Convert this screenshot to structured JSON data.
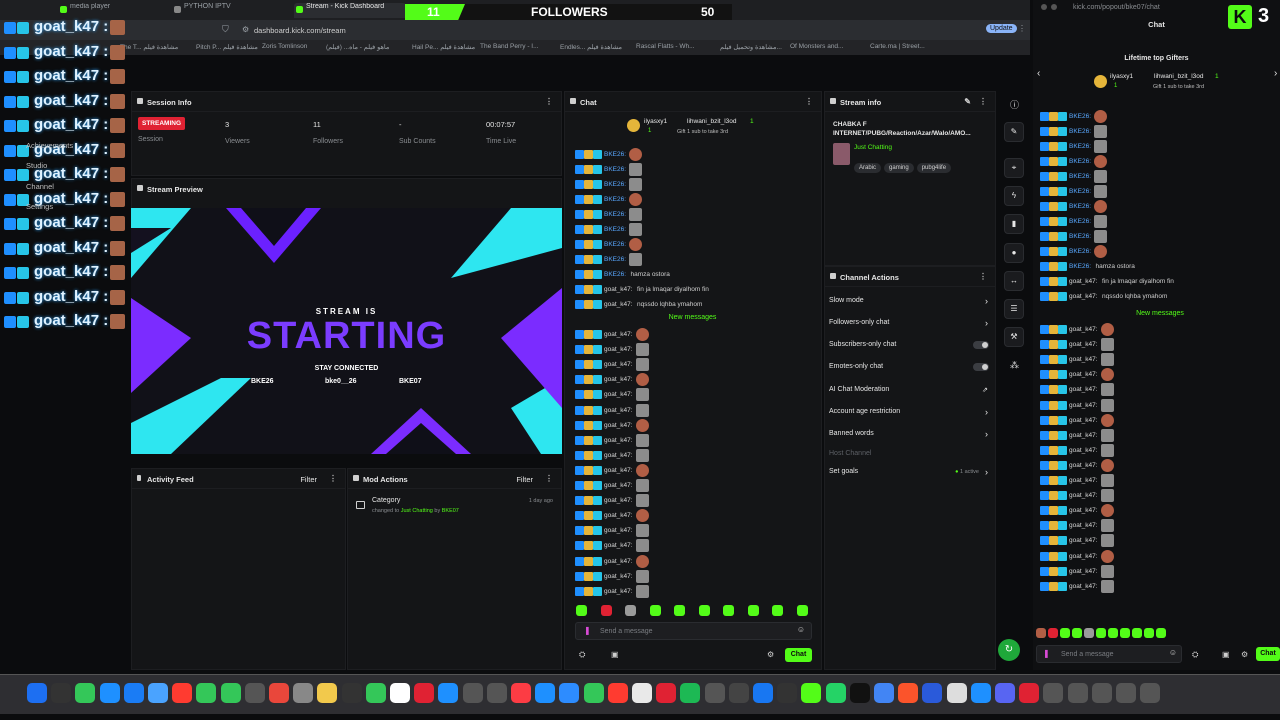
{
  "browser": {
    "tabs": [
      {
        "label": "media player"
      },
      {
        "label": "PYTHON IPTV"
      },
      {
        "label": "Stream - Kick Dashboard"
      }
    ],
    "url": "dashboard.kick.com/stream",
    "update_label": "Update",
    "bookmarks": [
      "The T... مشاهدة فيلم",
      "Pitch P... مشاهدة فيلم",
      "Zoris Tomlinson",
      "ماهو فيلم - ماه... (فيلم)",
      "Hail Pe... مشاهدة فيلم",
      "The Band Perry - I...",
      "Endles... مشاهدة فيلم",
      "Rascal Flatts - Wh...",
      "مشاهدة وتحميل فيلم...",
      "Of Monsters and...",
      "Carte.ma | Street..."
    ]
  },
  "follower_goal": {
    "current": "11",
    "label": "FOLLOWERS",
    "target": "50",
    "progress": 0.22
  },
  "overlay": {
    "rows": [
      "goat_k47 :",
      "goat_k47 :",
      "goat_k47 :",
      "goat_k47 :",
      "goat_k47 :",
      "goat_k47 :",
      "goat_k47 :",
      "goat_k47 :",
      "goat_k47 :",
      "goat_k47 :",
      "goat_k47 :",
      "goat_k47 :",
      "goat_k47 :"
    ],
    "menu": [
      "Achievements",
      "Studio",
      "Channel",
      "Settings"
    ]
  },
  "session": {
    "title": "Session Info",
    "status": "STREAMING",
    "session_label": "Session",
    "viewers": "3",
    "viewers_label": "Viewers",
    "followers": "11",
    "followers_label": "Followers",
    "subs": "-",
    "subs_label": "Sub Counts",
    "time": "00:07:57",
    "time_label": "Time Live"
  },
  "preview": {
    "title": "Stream Preview",
    "line1": "STREAM IS",
    "line2": "STARTING",
    "line3": "STAY CONNECTED",
    "handles": [
      "BKE26",
      "bke0__26",
      "BKE07"
    ]
  },
  "activity": {
    "title": "Activity Feed",
    "filter": "Filter"
  },
  "mod_actions": {
    "title": "Mod Actions",
    "filter": "Filter",
    "item_title": "Category",
    "item_prefix": "changed to",
    "item_value": "Just Chatting",
    "item_by": "by",
    "item_user": "BKE07",
    "item_time": "1 day ago"
  },
  "chat": {
    "title": "Chat",
    "gifter1": "ilyasxy1",
    "gifter1_count": "1",
    "gifter2": "lihwani_bzit_l3od",
    "gifter2_count": "1",
    "gift_note": "Gift 1 sub to take 3rd",
    "messages_top": [
      {
        "user": "BKE26:",
        "text": ""
      },
      {
        "user": "BKE26:",
        "text": ""
      },
      {
        "user": "BKE26:",
        "text": ""
      },
      {
        "user": "BKE26:",
        "text": ""
      },
      {
        "user": "BKE26:",
        "text": ""
      },
      {
        "user": "BKE26:",
        "text": ""
      },
      {
        "user": "BKE26:",
        "text": ""
      },
      {
        "user": "BKE26:",
        "text": ""
      },
      {
        "user": "BKE26:",
        "text": "hamza ostora"
      },
      {
        "user": "goat_k47:",
        "text": "fin ja lmaqar diyalhom fin"
      },
      {
        "user": "goat_k47:",
        "text": "nqssdo lqhba ymahom"
      }
    ],
    "new_messages": "New messages",
    "messages_bottom": [
      "goat_k47:",
      "goat_k47:",
      "goat_k47:",
      "goat_k47:",
      "goat_k47:",
      "goat_k47:",
      "goat_k47:",
      "goat_k47:",
      "goat_k47:",
      "goat_k47:",
      "goat_k47:",
      "goat_k47:",
      "goat_k47:",
      "goat_k47:",
      "goat_k47:",
      "goat_k47:",
      "goat_k47:",
      "goat_k47:"
    ],
    "placeholder": "Send a message",
    "send": "Chat"
  },
  "stream_info": {
    "title": "Stream info",
    "stream_title": "CHABKA F INTERNET/PUBG/Reaction/Azar/Walo/AMO...",
    "category": "Just Chatting",
    "tags": [
      "Arabic",
      "gaming",
      "pubg4life"
    ]
  },
  "channel_actions": {
    "title": "Channel Actions",
    "items": [
      {
        "label": "Slow mode",
        "kind": "chevron"
      },
      {
        "label": "Followers-only chat",
        "kind": "chevron"
      },
      {
        "label": "Subscribers-only chat",
        "kind": "toggle"
      },
      {
        "label": "Emotes-only chat",
        "kind": "toggle"
      },
      {
        "label": "AI Chat Moderation",
        "kind": "external"
      },
      {
        "label": "Account age restriction",
        "kind": "chevron"
      },
      {
        "label": "Banned words",
        "kind": "chevron"
      }
    ],
    "host_channel": "Host Channel",
    "set_goals": "Set goals",
    "active_count": "1 active"
  },
  "popout": {
    "url": "kick.com/popout/bke07/chat",
    "title": "Chat",
    "top_gifters": "Lifetime top Gifters",
    "gifter1": "ilyasxy1",
    "gifter1_count": "1",
    "gifter2": "lihwani_bzit_l3od",
    "gifter2_count": "1",
    "gift_note": "Gift 1 sub to take 3rd",
    "messages_top": [
      {
        "user": "BKE26:",
        "text": ""
      },
      {
        "user": "BKE26:",
        "text": ""
      },
      {
        "user": "BKE26:",
        "text": ""
      },
      {
        "user": "BKE26:",
        "text": ""
      },
      {
        "user": "BKE26:",
        "text": ""
      },
      {
        "user": "BKE26:",
        "text": ""
      },
      {
        "user": "BKE26:",
        "text": ""
      },
      {
        "user": "BKE26:",
        "text": ""
      },
      {
        "user": "BKE26:",
        "text": ""
      },
      {
        "user": "BKE26:",
        "text": ""
      },
      {
        "user": "BKE26:",
        "text": "hamza ostora"
      },
      {
        "user": "goat_k47:",
        "text": "fin ja lmaqar diyalhom fin"
      },
      {
        "user": "goat_k47:",
        "text": "nqssdo lqhba ymahom"
      }
    ],
    "new_messages": "New messages",
    "messages_bottom": [
      "goat_k47:",
      "goat_k47:",
      "goat_k47:",
      "goat_k47:",
      "goat_k47:",
      "goat_k47:",
      "goat_k47:",
      "goat_k47:",
      "goat_k47:",
      "goat_k47:",
      "goat_k47:",
      "goat_k47:",
      "goat_k47:",
      "goat_k47:",
      "goat_k47:",
      "goat_k47:",
      "goat_k47:",
      "goat_k47:"
    ],
    "placeholder": "Send a message",
    "send": "Chat"
  },
  "kick_badge": {
    "number": "3"
  },
  "colors": {
    "accent": "#53fc18",
    "live": "#e02233",
    "panel": "#141517"
  }
}
